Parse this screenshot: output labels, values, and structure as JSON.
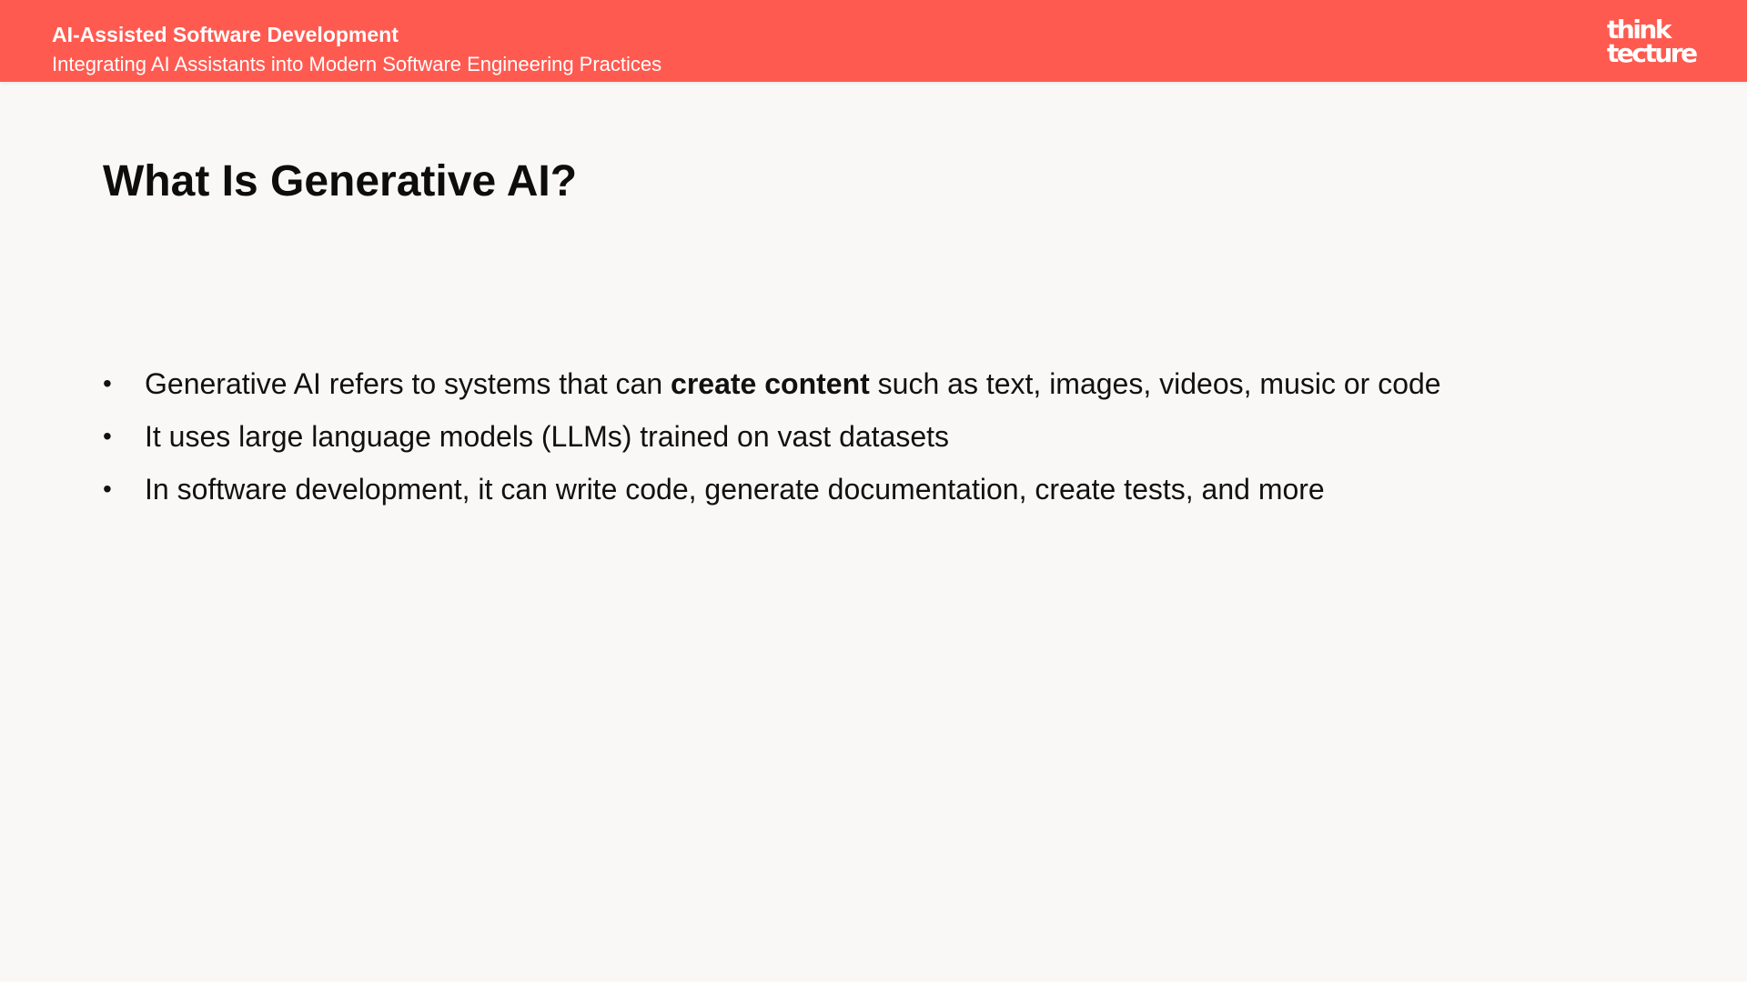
{
  "header": {
    "title": "AI-Assisted Software Development",
    "subtitle": "Integrating AI Assistants into Modern Software Engineering Practices",
    "logo_line1": "think",
    "logo_line2": "tecture",
    "accent_color": "#ff5a50"
  },
  "slide": {
    "title": "What Is Generative AI?",
    "bullets": [
      {
        "prefix": "Generative AI refers to systems that can ",
        "bold": "create content",
        "suffix": " such as text, images, videos, music or code"
      },
      {
        "text": "It uses large language models (LLMs) trained on vast datasets"
      },
      {
        "text": "In software development, it can write code, generate documentation, create tests, and more"
      }
    ],
    "bullet_symbol": "•"
  }
}
